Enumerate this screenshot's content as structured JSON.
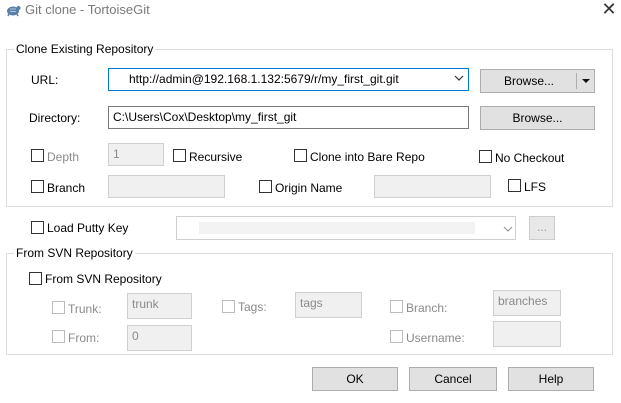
{
  "window": {
    "title": "Git clone - TortoiseGit",
    "close_glyph": "✕",
    "icon": "tortoise-icon"
  },
  "clone_group": {
    "label": "Clone Existing Repository",
    "url_label": "URL:",
    "url_value": "http://admin@192.168.1.132:5679/r/my_first_git.git",
    "url_browse_label": "Browse...",
    "directory_label": "Directory:",
    "directory_value": "C:\\Users\\Cox\\Desktop\\my_first_git",
    "directory_browse_label": "Browse...",
    "depth_label": "Depth",
    "depth_value": "1",
    "recursive_label": "Recursive",
    "bare_label": "Clone into Bare Repo",
    "no_checkout_label": "No Checkout",
    "branch_label": "Branch",
    "branch_value": "",
    "origin_label": "Origin Name",
    "origin_value": "",
    "lfs_label": "LFS"
  },
  "putty": {
    "label": "Load Putty Key",
    "value": "",
    "browse_label": "..."
  },
  "svn_group": {
    "label": "From SVN Repository",
    "checkbox_label": "From SVN Repository",
    "trunk_label": "Trunk:",
    "trunk_value": "trunk",
    "tags_label": "Tags:",
    "tags_value": "tags",
    "branch_label": "Branch:",
    "branch_value": "branches",
    "from_label": "From:",
    "from_value": "0",
    "username_label": "Username:",
    "username_value": ""
  },
  "footer": {
    "ok_label": "OK",
    "cancel_label": "Cancel",
    "help_label": "Help"
  }
}
